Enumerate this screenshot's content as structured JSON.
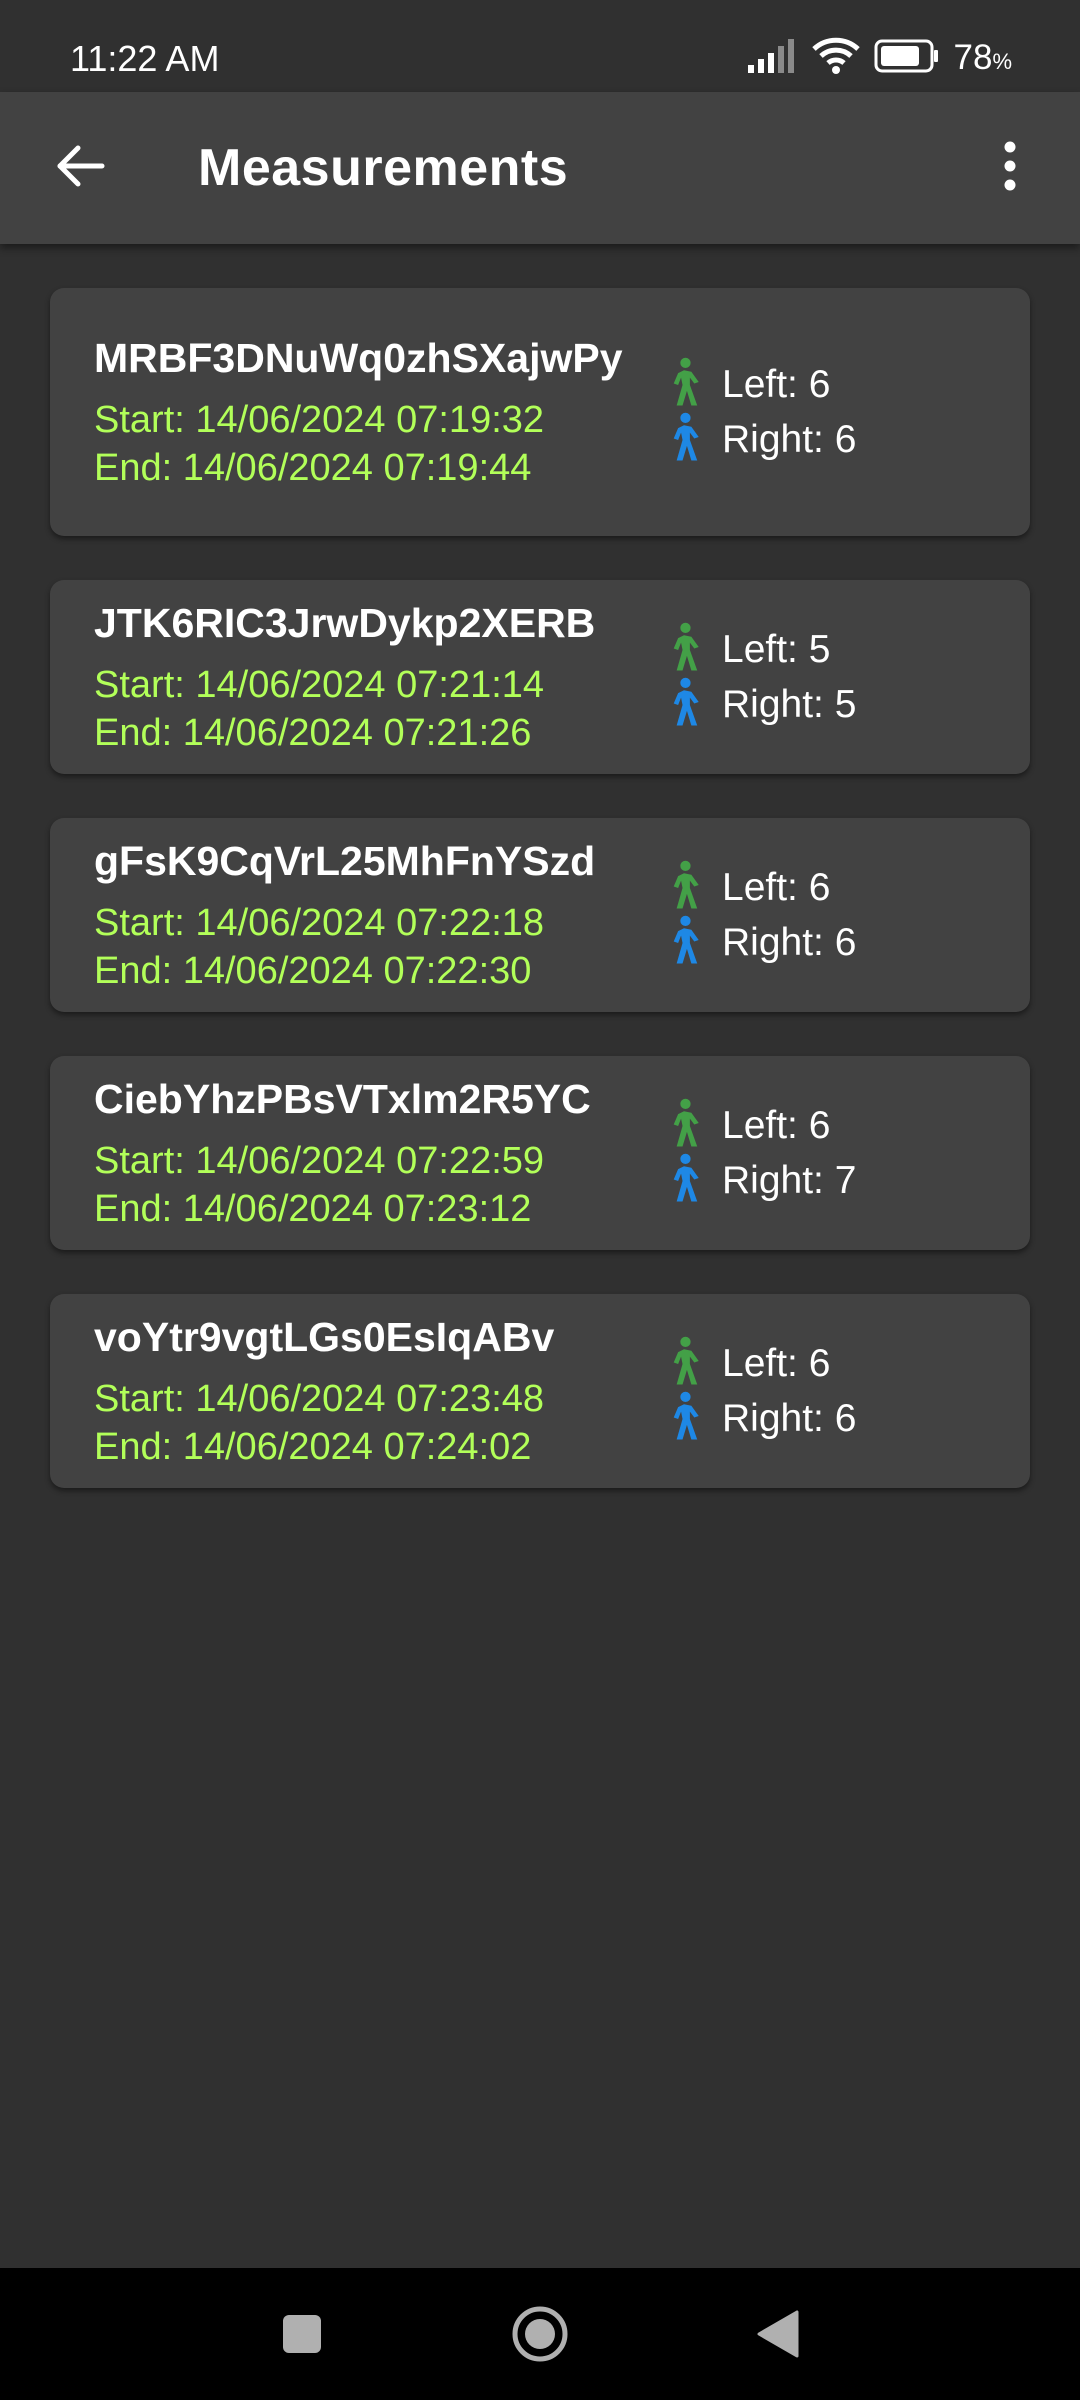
{
  "status_bar": {
    "time": "11:22 AM",
    "battery_value": "78",
    "battery_unit": "%"
  },
  "app_bar": {
    "title": "Measurements"
  },
  "measurements": [
    {
      "id": "MRBF3DNuWq0zhSXajwPy",
      "start": "Start: 14/06/2024 07:19:32",
      "end": "End: 14/06/2024 07:19:44",
      "left": "Left: 6",
      "right": "Right: 6"
    },
    {
      "id": "JTK6RIC3JrwDykp2XERB",
      "start": "Start: 14/06/2024 07:21:14",
      "end": "End: 14/06/2024 07:21:26",
      "left": "Left: 5",
      "right": "Right: 5"
    },
    {
      "id": "gFsK9CqVrL25MhFnYSzd",
      "start": "Start: 14/06/2024 07:22:18",
      "end": "End: 14/06/2024 07:22:30",
      "left": "Left: 6",
      "right": "Right: 6"
    },
    {
      "id": "CiebYhzPBsVTxlm2R5YC",
      "start": "Start: 14/06/2024 07:22:59",
      "end": "End: 14/06/2024 07:23:12",
      "left": "Left: 6",
      "right": "Right: 7"
    },
    {
      "id": "voYtr9vgtLGs0EsIqABv",
      "start": "Start: 14/06/2024 07:23:48",
      "end": "End: 14/06/2024 07:24:02",
      "left": "Left: 6",
      "right": "Right: 6"
    }
  ],
  "icons": {
    "left_foot": "walking-person-icon",
    "right_foot": "walking-person-icon",
    "back": "arrow-back-icon",
    "menu": "more-vert-icon"
  },
  "colors": {
    "background": "#303030",
    "app_bar": "#424242",
    "card": "#424242",
    "date_text": "#b2ff59",
    "left_icon": "#43a047",
    "right_icon": "#1e88e5"
  }
}
